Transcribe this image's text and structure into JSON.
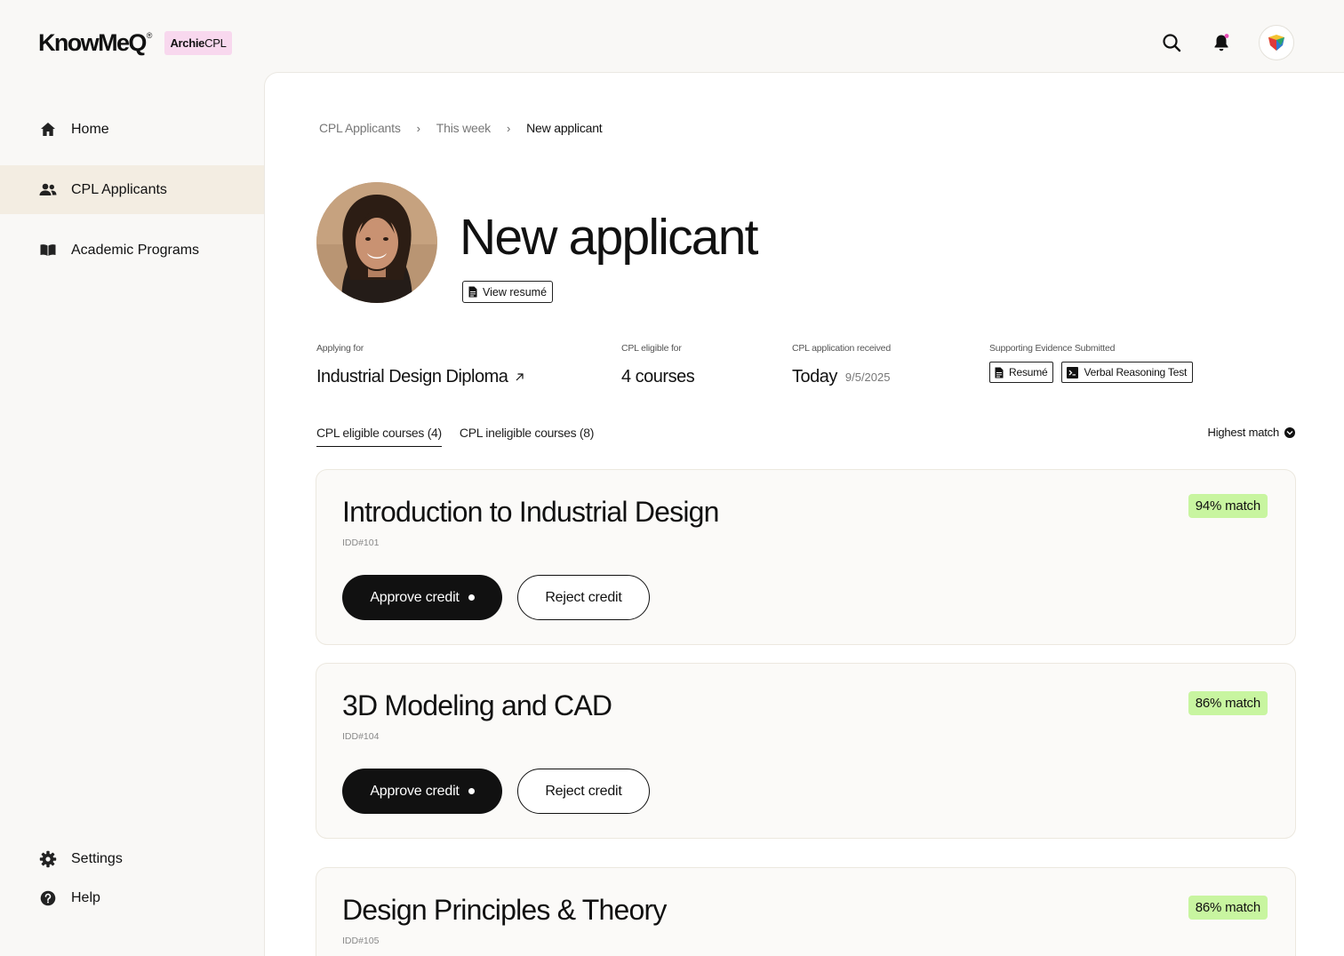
{
  "brand": {
    "name": "KnowMeQ",
    "reg": "®",
    "product_bold": "Archie",
    "product_rest": "CPL"
  },
  "topbar": {
    "icons": [
      "search-icon",
      "bell-icon",
      "profile-logo-icon"
    ],
    "notification_dot_color": "#e84bb5"
  },
  "sidebar": {
    "items": [
      {
        "label": "Home",
        "icon": "home-icon"
      },
      {
        "label": "CPL Applicants",
        "icon": "users-icon",
        "active": true
      },
      {
        "label": "Academic Programs",
        "icon": "book-icon"
      }
    ],
    "footer": [
      {
        "label": "Settings",
        "icon": "gear-icon"
      },
      {
        "label": "Help",
        "icon": "help-icon"
      }
    ]
  },
  "breadcrumb": {
    "items": [
      "CPL Applicants",
      "This week",
      "New applicant"
    ],
    "separator": "›"
  },
  "applicant": {
    "title": "New applicant",
    "view_resume_label": "View resumé"
  },
  "stats": {
    "applying_for": {
      "label": "Applying for",
      "value": "Industrial Design Diploma"
    },
    "eligible": {
      "label": "CPL eligible for",
      "value": "4 courses"
    },
    "received": {
      "label": "CPL application received",
      "value": "Today",
      "date": "9/5/2025"
    },
    "evidence": {
      "label": "Supporting Evidence Submitted",
      "items": [
        "Resumé",
        "Verbal Reasoning Test"
      ]
    }
  },
  "tabs": [
    {
      "label": "CPL eligible courses (4)",
      "active": true
    },
    {
      "label": "CPL ineligible courses (8)",
      "active": false
    }
  ],
  "sort": {
    "label": "Highest match"
  },
  "courses": [
    {
      "title": "Introduction to Industrial Design",
      "code": "IDD#101",
      "match": "94% match"
    },
    {
      "title": "3D Modeling and CAD",
      "code": "IDD#104",
      "match": "86% match"
    },
    {
      "title": "Design Principles & Theory",
      "code": "IDD#105",
      "match": "86% match"
    }
  ],
  "actions": {
    "approve": "Approve credit",
    "reject": "Reject credit"
  },
  "colors": {
    "match_badge": "#c8f5a0",
    "active_nav": "#f3ede2",
    "brand_badge": "#f8d8ee",
    "primary_button": "#111111"
  }
}
